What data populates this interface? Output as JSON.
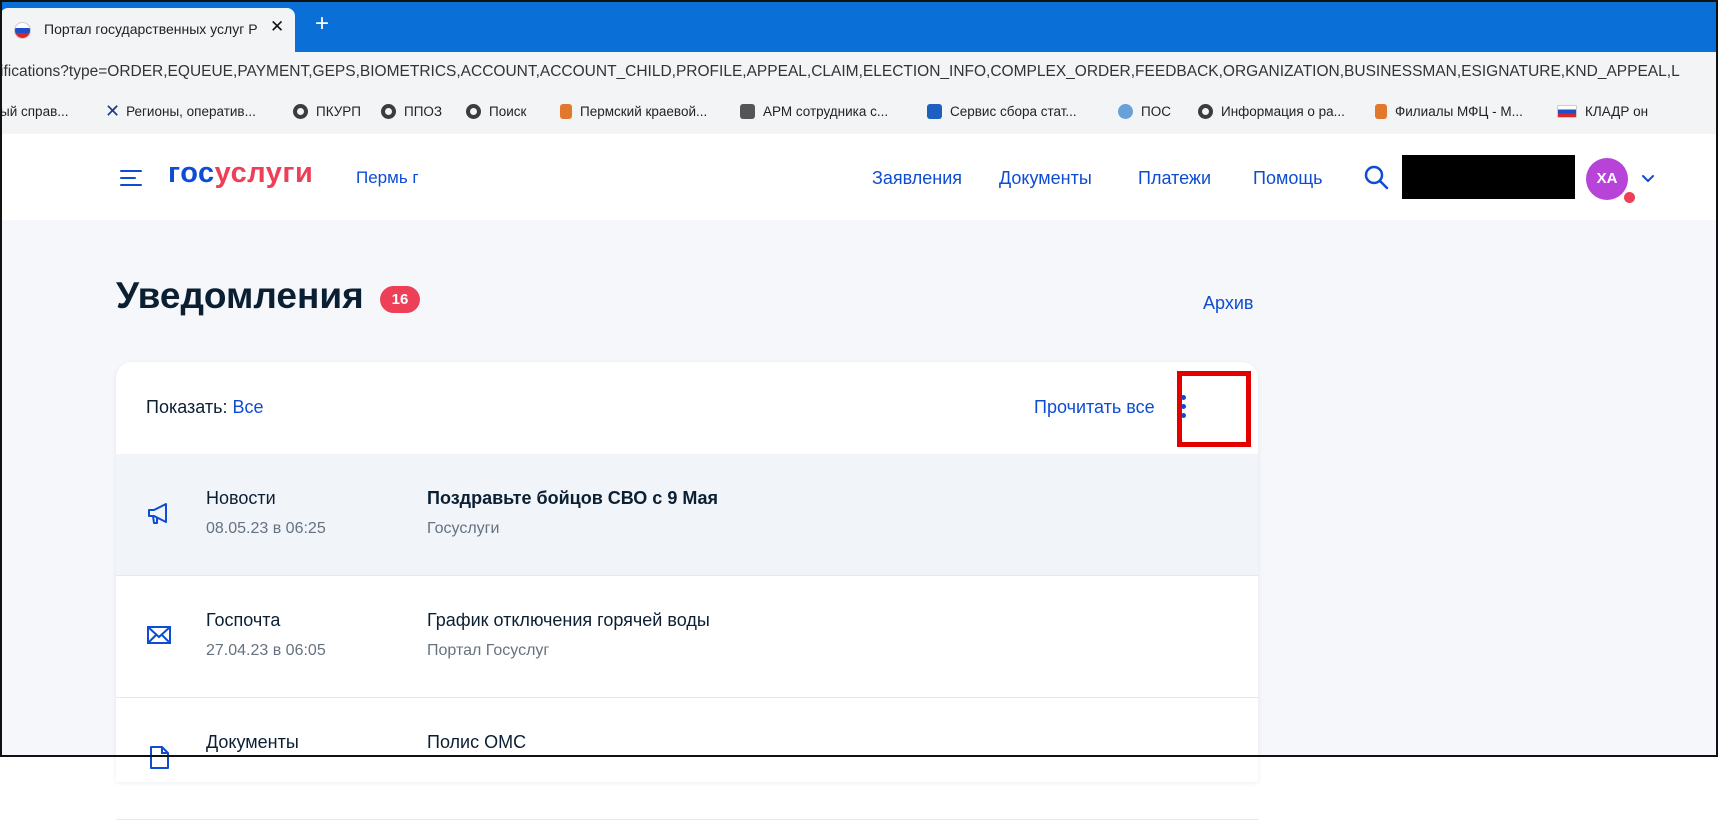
{
  "browser": {
    "tab_title": "Портал государственных услуг Р",
    "tab_close": "✕",
    "new_tab": "+",
    "url": "ifications?type=ORDER,EQUEUE,PAYMENT,GEPS,BIOMETRICS,ACCOUNT,ACCOUNT_CHILD,PROFILE,APPEAL,CLAIM,ELECTION_INFO,COMPLEX_ORDER,FEEDBACK,ORGANIZATION,BUSINESSMAN,ESIGNATURE,KND_APPEAL,L",
    "bookmarks": [
      {
        "label": "ый справ...",
        "icon": "none"
      },
      {
        "label": "Регионы, оператив...",
        "icon": "x-logo-icon"
      },
      {
        "label": "ПКУРП",
        "icon": "globe-icon"
      },
      {
        "label": "ППОЗ",
        "icon": "globe-icon"
      },
      {
        "label": "Поиск",
        "icon": "globe-icon"
      },
      {
        "label": "Пермский краевой...",
        "icon": "orange-shield-icon"
      },
      {
        "label": "АРМ сотрудника с...",
        "icon": "arm-icon"
      },
      {
        "label": "Сервис сбора стат...",
        "icon": "blue-c-icon"
      },
      {
        "label": "ПОС",
        "icon": "pos-icon"
      },
      {
        "label": "Информация о ра...",
        "icon": "globe-icon"
      },
      {
        "label": "Филиалы МФЦ - М...",
        "icon": "orange-shield-icon"
      },
      {
        "label": "КЛАДР он",
        "icon": "ru-flag-icon"
      }
    ]
  },
  "header": {
    "logo_part1": "гос",
    "logo_part2": "услуги",
    "city": "Пермь г",
    "nav": [
      "Заявления",
      "Документы",
      "Платежи",
      "Помощь"
    ],
    "avatar_initials": "ХА"
  },
  "main": {
    "title": "Уведомления",
    "count": "16",
    "archive_link": "Архив",
    "filter_label": "Показать:",
    "filter_value": "Все",
    "read_all": "Прочитать все",
    "notifications": [
      {
        "category": "Новости",
        "date": "08.05.23 в 06:25",
        "title": "Поздравьте бойцов СВО с 9 Мая",
        "source": "Госуслуги",
        "icon": "megaphone-icon",
        "unread": true
      },
      {
        "category": "Госпочта",
        "date": "27.04.23 в 06:05",
        "title": "График отключения горячей воды",
        "source": "Портал Госуслуг",
        "icon": "envelope-icon",
        "unread": false
      },
      {
        "category": "Документы",
        "date": "",
        "title": "Полис ОМС",
        "source": "",
        "icon": "document-icon",
        "unread": false
      }
    ]
  },
  "colors": {
    "brand_blue": "#0d4cd3",
    "brand_red": "#ee3f58",
    "chrome_blue": "#0a6fd6",
    "highlight": "#e50000",
    "avatar": "#b743d9"
  }
}
